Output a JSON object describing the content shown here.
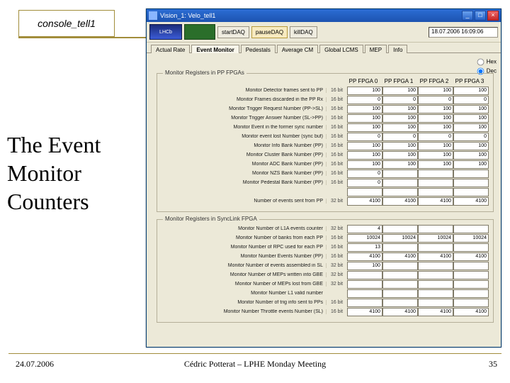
{
  "slide": {
    "title": "console_tell1",
    "slogan_line1": "The Event",
    "slogan_line2": "Monitor",
    "slogan_line3": "Counters",
    "footer_date": "24.07.2006",
    "footer_center": "Cédric Potterat – LPHE Monday Meeting",
    "footer_num": "35"
  },
  "window": {
    "title": "Vision_1: Velo_tell1",
    "datetime": "18.07.2006  16:09:06",
    "toolbar": {
      "btn_start": "startDAQ",
      "btn_pause": "pauseDAQ",
      "btn_kill": "killDAQ"
    },
    "tabs": [
      "Actual Rate",
      "Event Monitor",
      "Pedestals",
      "Average CM",
      "Global LCMS",
      "MEP",
      "Info"
    ],
    "active_tab": 1,
    "side": {
      "hex": "Hex",
      "dec": "Dec"
    },
    "group1": {
      "title": "Monitor Registers in PP FPGAs",
      "cols": [
        "PP FPGA 0",
        "PP FPGA 1",
        "PP FPGA 2",
        "PP FPGA 3"
      ],
      "rows": [
        {
          "label": "Monitor Detector frames sent to PP",
          "w": "16 bit",
          "v": [
            "100",
            "100",
            "100",
            "100"
          ]
        },
        {
          "label": "Monitor Frames discarded in the PP Rx",
          "w": "16 bit",
          "v": [
            "0",
            "0",
            "0",
            "0"
          ]
        },
        {
          "label": "Monitor Trigger Request Number (PP->SL)",
          "w": "16 bit",
          "v": [
            "100",
            "100",
            "100",
            "100"
          ]
        },
        {
          "label": "Monitor Trigger Answer Number (SL->PP)",
          "w": "16 bit",
          "v": [
            "100",
            "100",
            "100",
            "100"
          ]
        },
        {
          "label": "Monitor Event in the former sync number",
          "w": "16 bit",
          "v": [
            "100",
            "100",
            "100",
            "100"
          ]
        },
        {
          "label": "Monitor event lost Number (sync buf)",
          "w": "16 bit",
          "v": [
            "0",
            "0",
            "0",
            "0"
          ]
        },
        {
          "label": "Monitor Info Bank Number (PP)",
          "w": "16 bit",
          "v": [
            "100",
            "100",
            "100",
            "100"
          ]
        },
        {
          "label": "Monitor Cluster Bank Number (PP)",
          "w": "16 bit",
          "v": [
            "100",
            "100",
            "100",
            "100"
          ]
        },
        {
          "label": "Monitor ADC Bank Number (PP)",
          "w": "16 bit",
          "v": [
            "100",
            "100",
            "100",
            "100"
          ]
        },
        {
          "label": "Monitor NZS Bank Number (PP)",
          "w": "16 bit",
          "v": [
            "0",
            "",
            "",
            ""
          ]
        },
        {
          "label": "Monitor Pedestal Bank Number (PP)",
          "w": "16 bit",
          "v": [
            "0",
            "",
            "",
            ""
          ]
        },
        {
          "label": "",
          "w": "",
          "v": [
            "",
            "",
            "",
            ""
          ]
        },
        {
          "label": "Number of events sent from PP",
          "w": "32 bit",
          "v": [
            "4100",
            "4100",
            "4100",
            "4100"
          ]
        }
      ]
    },
    "group2": {
      "title": "Monitor Registers in SyncLink FPGA",
      "rows": [
        {
          "label": "Monitor Number of L1A events counter",
          "w": "32 bit",
          "v": [
            "4",
            "",
            "",
            ""
          ]
        },
        {
          "label": "Monitor Number of banks from each PP",
          "w": "16 bit",
          "v": [
            "10024",
            "10024",
            "10024",
            "10024"
          ]
        },
        {
          "label": "Monitor Number of RPC used for each PP",
          "w": "16 bit",
          "v": [
            "13",
            "",
            "",
            ""
          ]
        },
        {
          "label": "Monitor Number Events Number (PP)",
          "w": "16 bit",
          "v": [
            "4100",
            "4100",
            "4100",
            "4100"
          ]
        },
        {
          "label": "Monitor Number of events assembled in SL",
          "w": "32 bit",
          "v": [
            "100",
            "",
            "",
            ""
          ]
        },
        {
          "label": "Monitor Number of MEPs written into GBE",
          "w": "32 bit",
          "v": [
            "",
            "",
            "",
            ""
          ]
        },
        {
          "label": "Monitor Number of MEPs lost from GBE",
          "w": "32 bit",
          "v": [
            "",
            "",
            "",
            ""
          ]
        },
        {
          "label": "Monitor Number L1 valid number",
          "w": "",
          "v": [
            "",
            "",
            "",
            ""
          ]
        },
        {
          "label": "Monitor Number of trig info sent to PPs",
          "w": "16 bit",
          "v": [
            "",
            "",
            "",
            ""
          ]
        },
        {
          "label": "Monitor Number Throttle events Number (SL)",
          "w": "16 bit",
          "v": [
            "4100",
            "4100",
            "4100",
            "4100"
          ]
        }
      ]
    }
  }
}
